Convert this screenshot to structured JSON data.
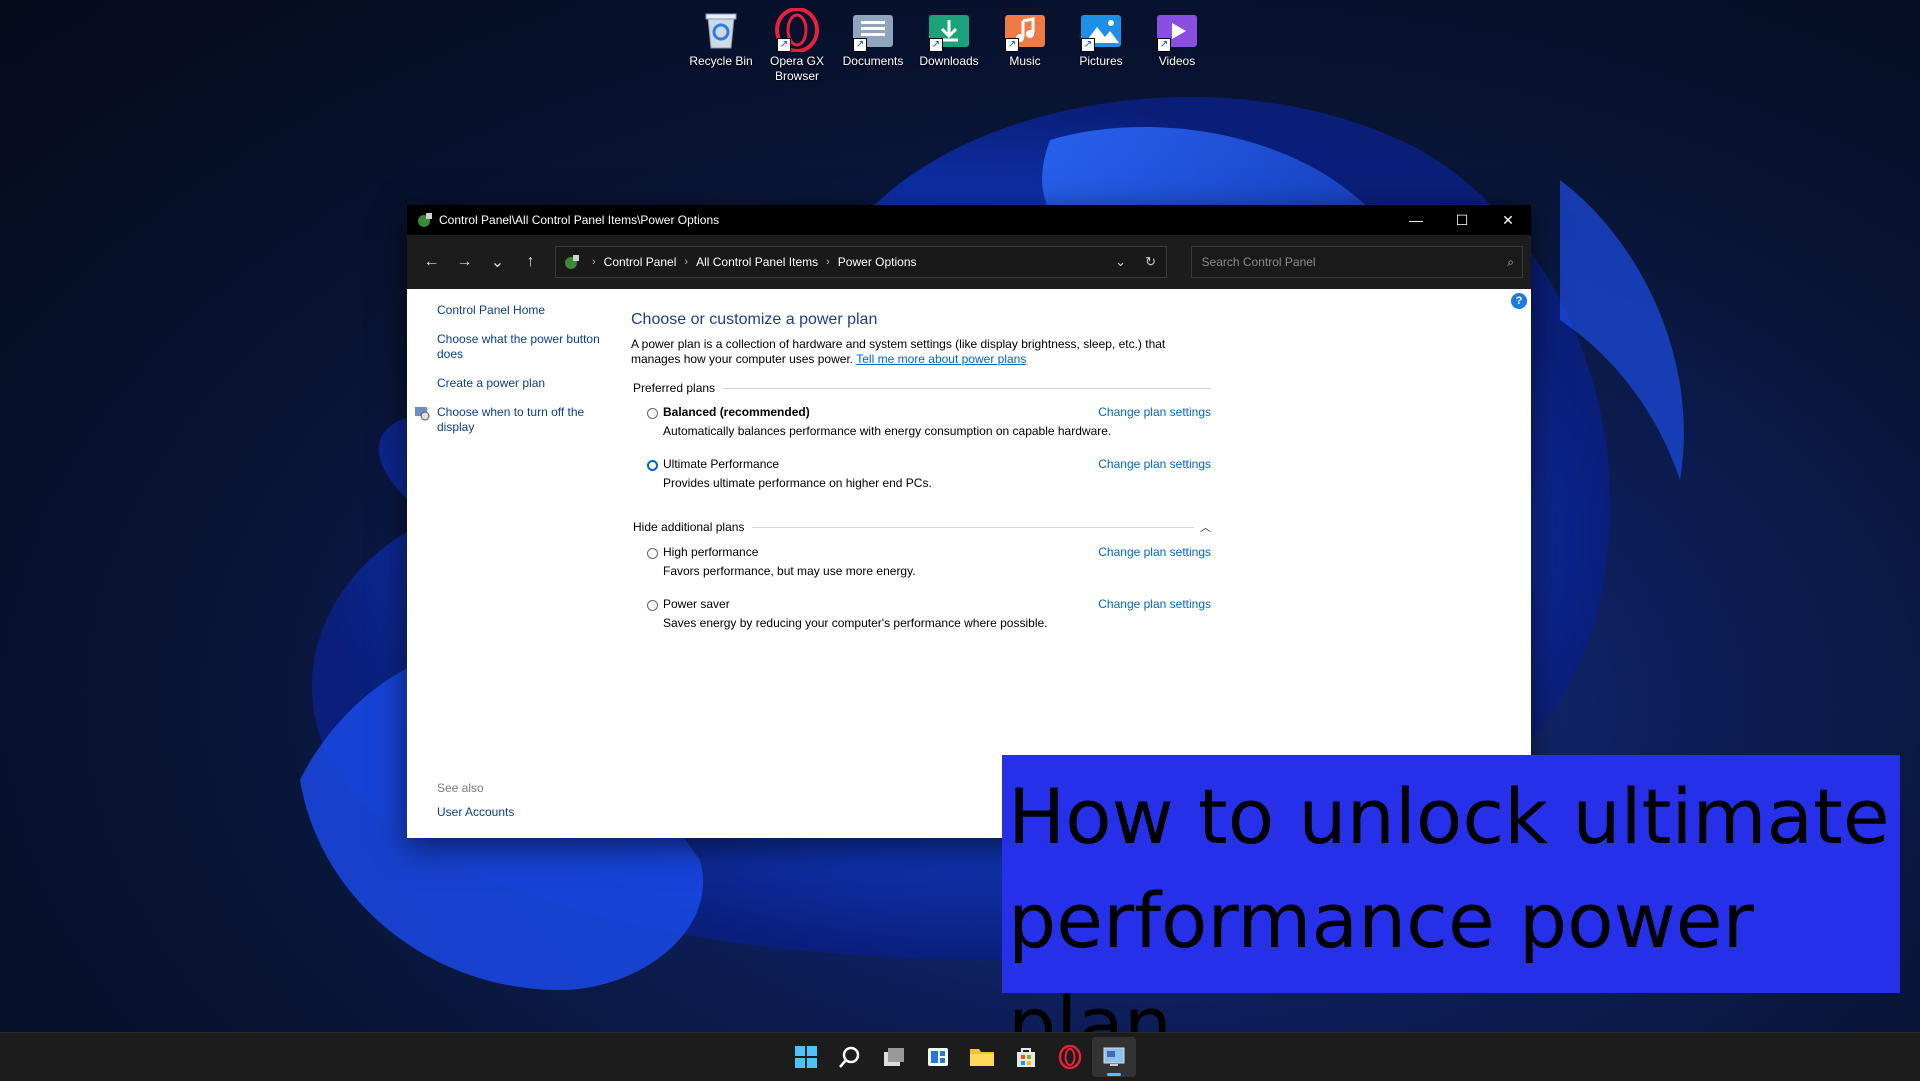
{
  "desktop": {
    "icons": [
      {
        "label": "Recycle Bin",
        "icon": "recycle-bin-icon"
      },
      {
        "label": "Opera GX Browser",
        "icon": "opera-gx-icon"
      },
      {
        "label": "Documents",
        "icon": "documents-folder-icon"
      },
      {
        "label": "Downloads",
        "icon": "downloads-folder-icon"
      },
      {
        "label": "Music",
        "icon": "music-folder-icon"
      },
      {
        "label": "Pictures",
        "icon": "pictures-folder-icon"
      },
      {
        "label": "Videos",
        "icon": "videos-folder-icon"
      }
    ]
  },
  "window": {
    "title": "Control Panel\\All Control Panel Items\\Power Options",
    "controls": {
      "minimize": "—",
      "maximize": "☐",
      "close": "✕"
    },
    "nav": {
      "back": "←",
      "forward": "→",
      "recent": "⌄",
      "up": "↑",
      "breadcrumb": [
        "Control Panel",
        "All Control Panel Items",
        "Power Options"
      ],
      "search_placeholder": "Search Control Panel"
    },
    "sidebar": {
      "home": "Control Panel Home",
      "links": [
        "Choose what the power button does",
        "Create a power plan",
        "Choose when to turn off the display"
      ],
      "see_also_title": "See also",
      "see_also_links": [
        "User Accounts"
      ]
    },
    "main": {
      "heading": "Choose or customize a power plan",
      "description": "A power plan is a collection of hardware and system settings (like display brightness, sleep, etc.) that manages how your computer uses power.",
      "learn_more": "Tell me more about power plans",
      "preferred_label": "Preferred plans",
      "hide_label": "Hide additional plans",
      "change_label": "Change plan settings",
      "preferred_plans": [
        {
          "name": "Balanced (recommended)",
          "desc": "Automatically balances performance with energy consumption on capable hardware.",
          "selected": false
        },
        {
          "name": "Ultimate Performance",
          "desc": "Provides ultimate performance on higher end PCs.",
          "selected": true
        }
      ],
      "additional_plans": [
        {
          "name": "High performance",
          "desc": "Favors performance, but may use more energy.",
          "selected": false
        },
        {
          "name": "Power saver",
          "desc": "Saves energy by reducing your computer's performance where possible.",
          "selected": false
        }
      ]
    }
  },
  "caption": {
    "line1": "How to unlock ultimate",
    "line2": "performance power plan"
  },
  "taskbar": {
    "items": [
      "start-icon",
      "search-icon",
      "task-view-icon",
      "widgets-icon",
      "file-explorer-icon",
      "microsoft-store-icon",
      "opera-gx-icon",
      "control-panel-icon"
    ]
  },
  "colors": {
    "caption_bg": "#2630e8",
    "link": "#0066cc",
    "heading": "#1a3f91",
    "taskbar_active": "#4cc2ff"
  }
}
